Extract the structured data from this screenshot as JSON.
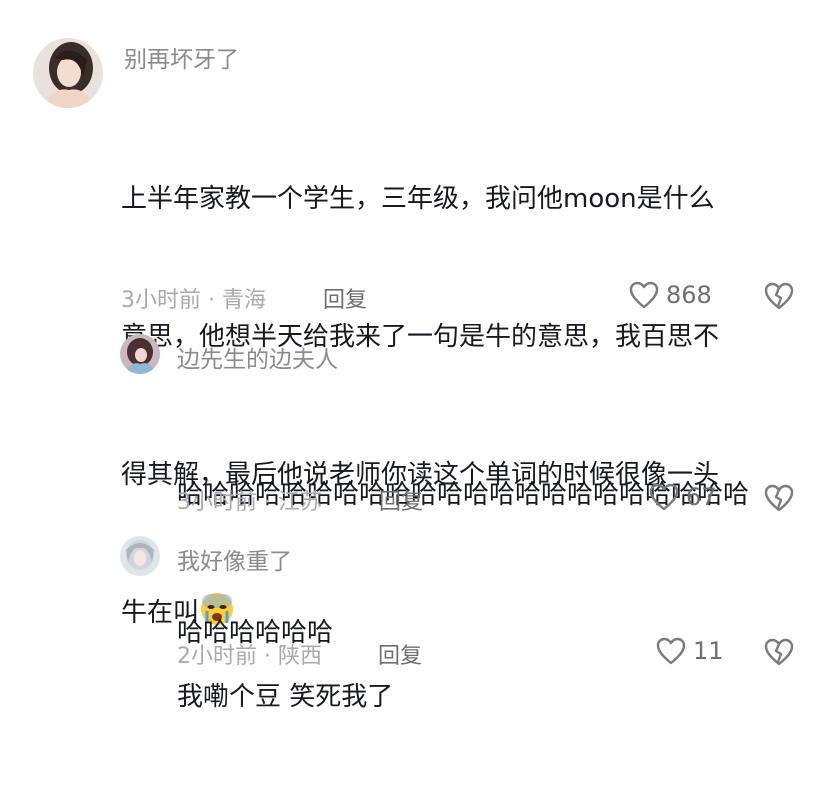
{
  "comments": [
    {
      "username": "别再坏牙了",
      "text_lines": [
        "上半年家教一个学生，三年级，我问他moon是什么",
        "意思，他想半天给我来了一句是牛的意思，我百思不",
        "得其解，最后他说老师你读这个单词的时候很像一头",
        "牛在叫"
      ],
      "emoji": "crying-face",
      "time_location": "3小时前 · 青海",
      "reply_label": "回复",
      "likes": "868"
    },
    {
      "username": "边先生的边夫人",
      "text_lines": [
        "哈哈哈哈哈哈哈哈哈哈哈哈哈哈哈哈哈哈哈哈哈哈",
        "哈哈哈哈哈哈"
      ],
      "time_location": "3小时前 · 江苏",
      "reply_label": "回复",
      "likes": "67"
    },
    {
      "username": "我好像重了",
      "text_lines": [
        "我嘞个豆 笑死我了"
      ],
      "time_location": "2小时前 · 陕西",
      "reply_label": "回复",
      "likes": "11"
    }
  ],
  "colors": {
    "text": "#161823",
    "username": "#8a8b91",
    "meta": "#a9aab0",
    "action": "#6e6f75"
  }
}
